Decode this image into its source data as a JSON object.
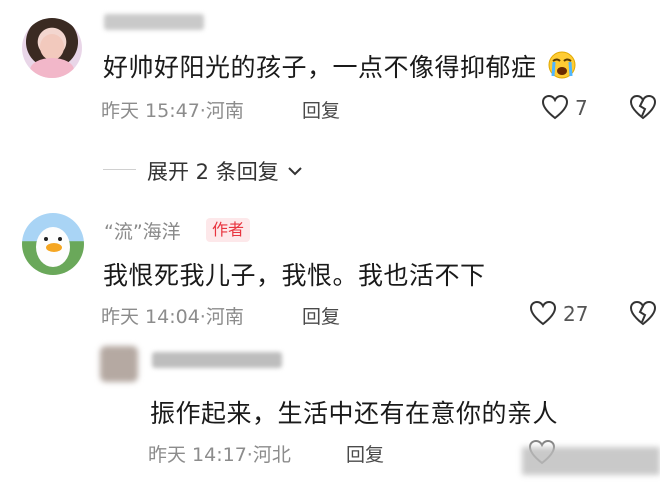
{
  "comments": [
    {
      "text": "好帅好阳光的孩子，一点不像得抑郁症",
      "emoji_icon": "crying-face-icon",
      "time": "昨天 15:47",
      "location": "河南",
      "reply_label": "回复",
      "likes": "7"
    },
    {
      "username": "“流”海洋",
      "badge": "作者",
      "text": "我恨死我儿子，我恨。我也活不下",
      "time": "昨天 14:04",
      "location": "河南",
      "reply_label": "回复",
      "likes": "27"
    }
  ],
  "expand": {
    "label": "展开 2 条回复"
  },
  "sub_reply": {
    "text": "振作起来，生活中还有在意你的亲人",
    "time": "昨天 14:17",
    "location": "河北",
    "reply_label": "回复"
  },
  "separator": "·",
  "colors": {
    "author_badge": "#e8343f",
    "meta": "#8c8c8c"
  }
}
